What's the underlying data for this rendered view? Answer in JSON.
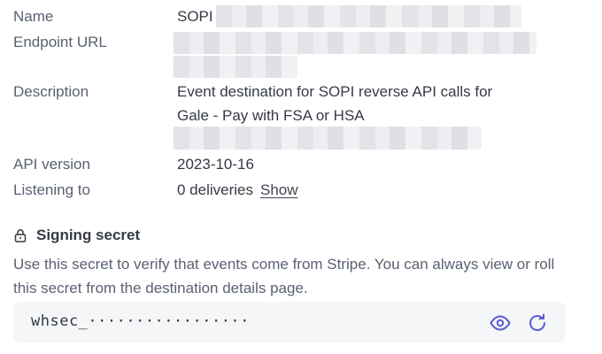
{
  "details": {
    "name_label": "Name",
    "name_value": "SOPI",
    "endpoint_label": "Endpoint URL",
    "description_label": "Description",
    "description_value_line1": "Event destination for SOPI reverse API calls for",
    "description_value_line2": "Gale - Pay with FSA or HSA",
    "api_version_label": "API version",
    "api_version_value": "2023-10-16",
    "listening_label": "Listening to",
    "listening_value": "0 deliveries",
    "show_link": "Show"
  },
  "signing_secret": {
    "title": "Signing secret",
    "description": "Use this secret to verify that events come from Stripe. You can always view or roll this secret from the destination details page.",
    "masked_value": "whsec_·················",
    "icons": [
      "eye-icon",
      "refresh-icon",
      "lock-icon"
    ]
  },
  "colors": {
    "accent": "#5b5bd6",
    "box_bg": "#f5f6f8",
    "label": "#596171"
  }
}
